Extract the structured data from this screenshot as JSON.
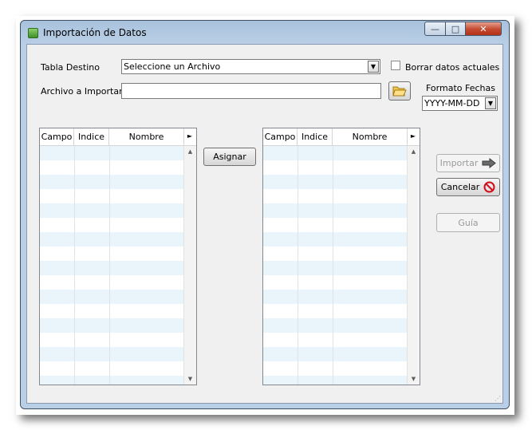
{
  "window": {
    "title": "Importación de Datos",
    "controls": {
      "minimize": "—",
      "maximize": "□",
      "close": "✕"
    }
  },
  "form": {
    "tabla_destino_label": "Tabla Destino",
    "tabla_destino_value": "Seleccione un Archivo",
    "borrar_label": "Borrar datos actuales",
    "borrar_checked": false,
    "archivo_label": "Archivo a Importar",
    "archivo_value": "",
    "formato_label": "Formato Fechas",
    "formato_value": "YYYY-MM-DD"
  },
  "grid_left": {
    "columns": [
      "Campo",
      "Indice",
      "Nombre"
    ],
    "rows": []
  },
  "grid_right": {
    "columns": [
      "Campo",
      "Indice",
      "Nombre"
    ],
    "rows": []
  },
  "buttons": {
    "asignar": "Asignar",
    "importar": "Importar",
    "cancelar": "Cancelar",
    "guia": "Guía"
  },
  "icons": {
    "folder": "folder-open-icon",
    "arrow": "arrow-right-icon",
    "cancel": "no-entry-icon"
  }
}
